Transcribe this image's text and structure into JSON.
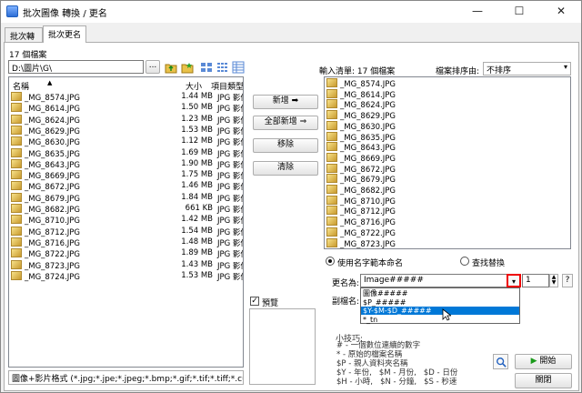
{
  "window": {
    "title": "批次圖像 轉換 / 更名",
    "minimize": "—",
    "maximize": "☐",
    "close": "✕"
  },
  "tabs": [
    "批次轉換",
    "批次更名"
  ],
  "left": {
    "file_count": "17 個檔案",
    "path": "D:\\圖片\\G\\",
    "browse": "...",
    "columns": {
      "name": "名稱",
      "size": "大小",
      "type": "項目類型"
    },
    "files": [
      {
        "name": "_MG_8574.JPG",
        "size": "1.44 MB",
        "type": "JPG 影像"
      },
      {
        "name": "_MG_8614.JPG",
        "size": "1.50 MB",
        "type": "JPG 影像"
      },
      {
        "name": "_MG_8624.JPG",
        "size": "1.23 MB",
        "type": "JPG 影像"
      },
      {
        "name": "_MG_8629.JPG",
        "size": "1.53 MB",
        "type": "JPG 影像"
      },
      {
        "name": "_MG_8630.JPG",
        "size": "1.12 MB",
        "type": "JPG 影像"
      },
      {
        "name": "_MG_8635.JPG",
        "size": "1.69 MB",
        "type": "JPG 影像"
      },
      {
        "name": "_MG_8643.JPG",
        "size": "1.90 MB",
        "type": "JPG 影像"
      },
      {
        "name": "_MG_8669.JPG",
        "size": "1.75 MB",
        "type": "JPG 影像"
      },
      {
        "name": "_MG_8672.JPG",
        "size": "1.46 MB",
        "type": "JPG 影像"
      },
      {
        "name": "_MG_8679.JPG",
        "size": "1.84 MB",
        "type": "JPG 影像"
      },
      {
        "name": "_MG_8682.JPG",
        "size": "661 KB",
        "type": "JPG 影像"
      },
      {
        "name": "_MG_8710.JPG",
        "size": "1.42 MB",
        "type": "JPG 影像"
      },
      {
        "name": "_MG_8712.JPG",
        "size": "1.54 MB",
        "type": "JPG 影像"
      },
      {
        "name": "_MG_8716.JPG",
        "size": "1.48 MB",
        "type": "JPG 影像"
      },
      {
        "name": "_MG_8722.JPG",
        "size": "1.89 MB",
        "type": "JPG 影像"
      },
      {
        "name": "_MG_8723.JPG",
        "size": "1.43 MB",
        "type": "JPG 影像"
      },
      {
        "name": "_MG_8724.JPG",
        "size": "1.53 MB",
        "type": "JPG 影像"
      }
    ],
    "filter": "圖像+影片格式 (*.jpg;*.jpe;*.jpeg;*.bmp;*.gif;*.tif;*.tiff;*.cur;*.ic"
  },
  "middle": {
    "add": "新增 ➡",
    "add_all": "全部新增 ⇒",
    "remove": "移除",
    "clear": "清除"
  },
  "right": {
    "input_list_label": "輸入清單: 17 個檔案",
    "sort_label": "檔案排序由:",
    "sort_value": "不排序",
    "files": [
      "_MG_8574.JPG",
      "_MG_8614.JPG",
      "_MG_8624.JPG",
      "_MG_8629.JPG",
      "_MG_8630.JPG",
      "_MG_8635.JPG",
      "_MG_8643.JPG",
      "_MG_8669.JPG",
      "_MG_8672.JPG",
      "_MG_8679.JPG",
      "_MG_8682.JPG",
      "_MG_8710.JPG",
      "_MG_8712.JPG",
      "_MG_8716.JPG",
      "_MG_8722.JPG",
      "_MG_8723.JPG"
    ]
  },
  "options": {
    "use_pattern": "使用名字範本命名",
    "find_replace": "查找替換",
    "rename_label": "更名為:",
    "rename_value": "Image#####",
    "start_number": "1",
    "help": "?",
    "ext_label": "副檔名:",
    "dropdown_items": [
      "圖像#####",
      "$P_#####",
      "$Y-$M-$D_#####",
      "*_tn"
    ],
    "dropdown_selected": 2,
    "preview": "預覽"
  },
  "tips": {
    "title": "小技巧:",
    "lines": "# - 一個數位連續的數字\n* - 原始的檔案名稱\n$P - 親人資料夾名稱\n$Y - 年份,   $M - 月份,   $D - 日份\n$H - 小時,   $N - 分鐘,   $S - 秒速"
  },
  "buttons": {
    "start": "開始",
    "close": "關閉"
  }
}
